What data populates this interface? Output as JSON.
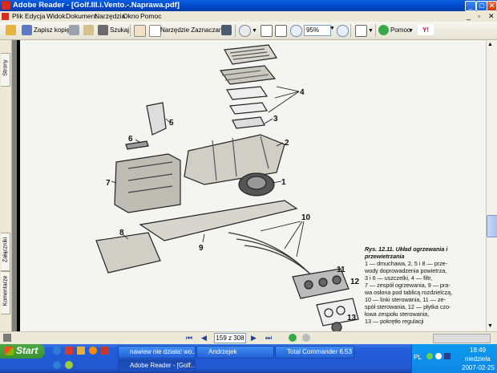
{
  "window": {
    "title": "Adobe Reader - [Golf.III.i.Vento.-.Naprawa.pdf]"
  },
  "menu": [
    "Plik",
    "Edycja",
    "Widok",
    "Dokument",
    "Narzędzia",
    "Okno",
    "Pomoc"
  ],
  "toolbar": {
    "save_copy": "Zapisz kopię",
    "search": "Szukaj",
    "select_tool": "Narzędzie Zaznaczanie",
    "zoom_value": "95%",
    "help": "Pomoc"
  },
  "left_tabs": [
    "Strony",
    "Załączniki",
    "Komentarze"
  ],
  "document": {
    "callouts": [
      "1",
      "2",
      "3",
      "4",
      "5",
      "6",
      "7",
      "8",
      "9",
      "10",
      "11",
      "12",
      "13"
    ],
    "caption_title": "Rys. 12.11. Układ ogrzewania i przewietrzania",
    "caption_lines": [
      "1 — dmuchawa, 2, 5 i 8 — prze-",
      "wody doprowadzenia powietrza,",
      "3 i 6 — uszczelki, 4 — filtr,",
      "7 — zespół ogrzewania, 9 — pra-",
      "wa osłona pod tablicą rozdzielczą,",
      "10 — linki sterowania, 11 — ze-",
      "spół sterowania, 12 — płytka czo-",
      "łowa zespołu sterowania,",
      "13 — pokrętło regulacji"
    ]
  },
  "statusbar": {
    "page_indicator": "159 z 308"
  },
  "taskbar": {
    "start": "Start",
    "tasks_row1": [
      "nawiew nie działa! wo...",
      "Andrzejek",
      "Total Commander 6.53"
    ],
    "tasks_row2": [
      "Adobe Reader - [Golf..."
    ],
    "language": "PL",
    "time": "18:49",
    "day": "niedziela",
    "date": "2007-02-25"
  },
  "colors": {
    "titlebar": "#0046c8",
    "taskbar": "#245edb",
    "start": "#3b9234",
    "tray": "#0f86e5"
  }
}
